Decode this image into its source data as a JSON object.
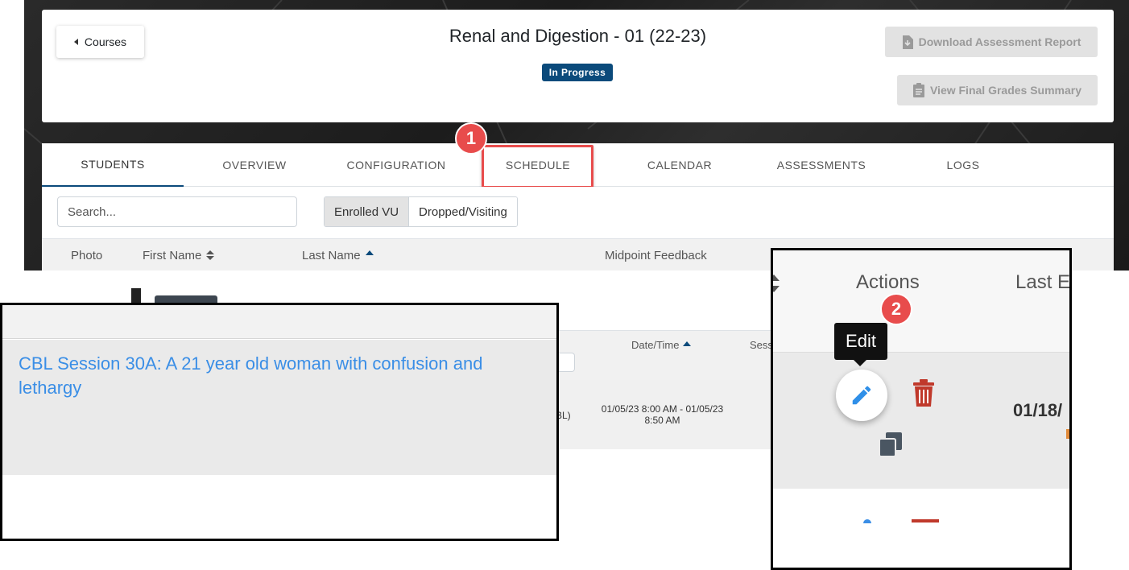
{
  "header": {
    "back_button_label": "Courses",
    "course_title": "Renal and Digestion - 01 (22-23)",
    "status_badge": "In Progress",
    "download_report_label": "Download Assessment Report",
    "final_grades_label": "View Final Grades Summary"
  },
  "tabs": [
    {
      "label": "STUDENTS"
    },
    {
      "label": "OVERVIEW"
    },
    {
      "label": "CONFIGURATION"
    },
    {
      "label": "SCHEDULE"
    },
    {
      "label": "CALENDAR"
    },
    {
      "label": "ASSESSMENTS"
    },
    {
      "label": "LOGS"
    }
  ],
  "active_tab": "STUDENTS",
  "highlighted_tab": "SCHEDULE",
  "filters": {
    "search_placeholder": "Search...",
    "toggle_options": [
      "Enrolled VU",
      "Dropped/Visiting"
    ],
    "selected_toggle": "Enrolled VU"
  },
  "student_table": {
    "columns": [
      "Photo",
      "First Name",
      "Last Name",
      "Midpoint Feedback"
    ]
  },
  "schedule_table": {
    "columns": [
      "Date/Time",
      "Sess"
    ],
    "row": {
      "session_fragment": "BL)",
      "datetime": "01/05/23 8:00 AM - 01/05/23 8:50 AM",
      "session_title": "CBL Session 30A: A 21 year old woman with confusion and lethargy"
    }
  },
  "zoom_actions": {
    "actions_header": "Actions",
    "last_header_fragment": "Last E",
    "tooltip": "Edit",
    "date_fragment": "01/18/"
  },
  "steps": [
    "1",
    "2"
  ],
  "colors": {
    "brand_blue": "#0b4a7b",
    "link_blue": "#3a8ee6",
    "step_red": "#e84c4c",
    "delete_red": "#c0392b"
  }
}
